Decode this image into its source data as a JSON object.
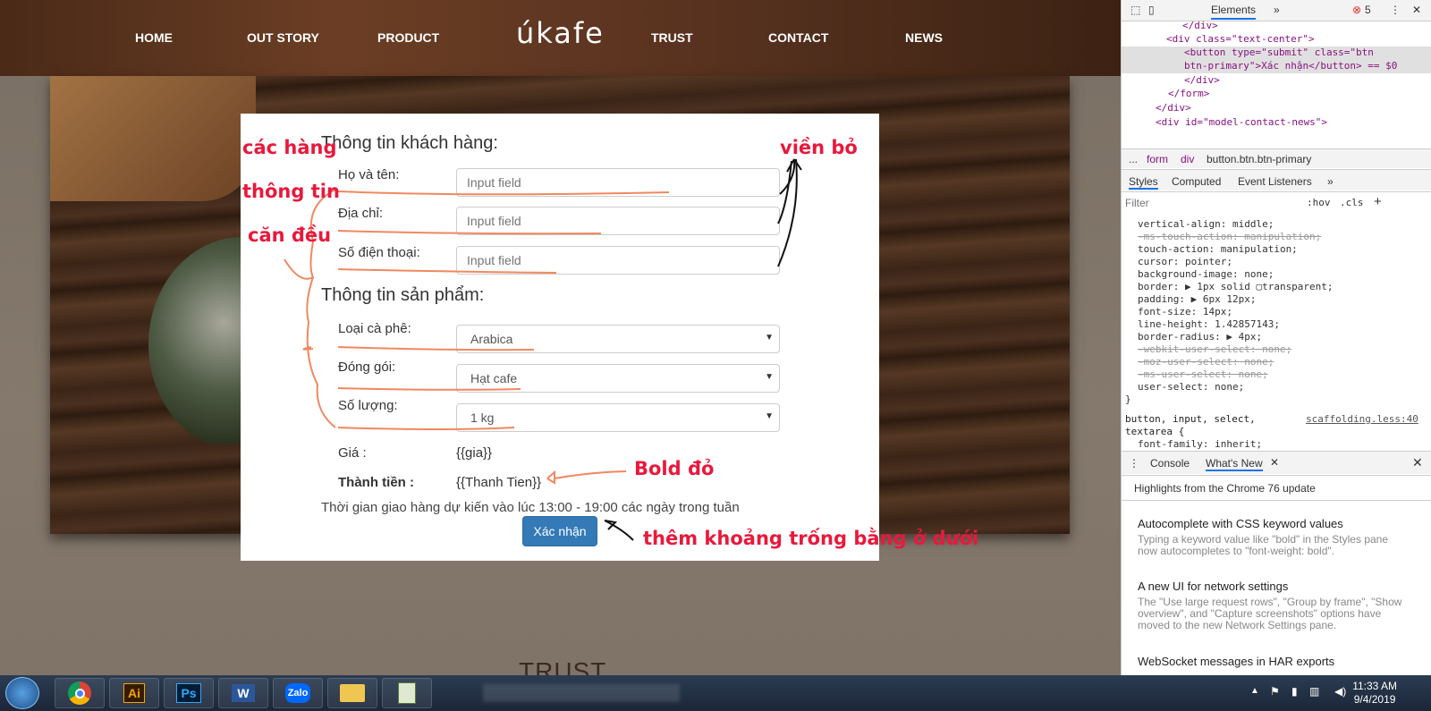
{
  "site": {
    "nav": {
      "home": "HOME",
      "story": "OUT STORY",
      "product": "PRODUCT",
      "logo": "úkafe",
      "trust": "TRUST",
      "contact": "CONTACT",
      "news": "NEWS"
    },
    "form": {
      "customer_title": "Thông tin khách hàng:",
      "name_label": "Họ và tên:",
      "address_label": "Địa chỉ:",
      "phone_label": "Số điện thoại:",
      "input_placeholder": "Input field",
      "product_title": "Thông tin sản phẩm:",
      "coffee_label": "Loại cà phê:",
      "coffee_value": "Arabica",
      "pack_label": "Đóng gói:",
      "pack_value": "Hạt cafe",
      "qty_label": "Số lượng:",
      "qty_value": "1 kg",
      "price_label": "Giá :",
      "price_value": "{{gia}}",
      "total_label": "Thành tiền :",
      "total_value": "{{Thanh Tien}}",
      "delivery_note": "Thời gian giao hàng dự kiến vào lúc 13:00 - 19:00 các ngày trong tuần",
      "submit_label": "Xác nhận"
    },
    "trust_heading": "TRUST"
  },
  "annotations": {
    "align_1": "các hàng",
    "align_2": "thông tin",
    "align_3": "căn đều",
    "border": "viền bỏ",
    "bold": "Bold đỏ",
    "spacing": "thêm khoảng trống bằng ở dưới",
    "color": "#e8193c"
  },
  "devtools": {
    "tab_elements": "Elements",
    "tab_more": "»",
    "error_count": "5",
    "html_lines": [
      "</div>",
      "<div class=\"text-center\">",
      "<button type=\"submit\" class=\"btn",
      "btn-primary\">Xác nhận</button> == $0",
      "</div>",
      "</form>",
      "</div>",
      "<div id=\"model-contact-news\">"
    ],
    "breadcrumb": [
      "...",
      "form",
      "div",
      "button.btn.btn-primary"
    ],
    "style_tabs": [
      "Styles",
      "Computed",
      "Event Listeners",
      "»"
    ],
    "filter_placeholder": "Filter",
    "hov": ":hov",
    "cls": ".cls",
    "css_lines": [
      "vertical-align: middle;",
      "-ms-touch-action: manipulation;",
      "touch-action: manipulation;",
      "cursor: pointer;",
      "background-image: none;",
      "border: ▶ 1px solid ▢transparent;",
      "padding: ▶ 6px 12px;",
      "font-size: 14px;",
      "line-height: 1.42857143;",
      "border-radius: ▶ 4px;",
      "-webkit-user-select: none;",
      "-moz-user-select: none;",
      "-ms-user-select: none;",
      "user-select: none;",
      "}"
    ],
    "selector": "button, input, select,",
    "selector2": "textarea {",
    "selector_source": "scaffolding.less:40",
    "font_family_line": "font-family: inherit;",
    "drawer_tabs": [
      "Console",
      "What's New"
    ],
    "highlights": "Highlights from the Chrome 76 update",
    "news": [
      {
        "title": "Autocomplete with CSS keyword values",
        "desc": "Typing a keyword value like \"bold\" in the Styles pane now autocompletes to \"font-weight: bold\"."
      },
      {
        "title": "A new UI for network settings",
        "desc": "The \"Use large request rows\", \"Group by frame\", \"Show overview\", and \"Capture screenshots\" options have moved to the new Network Settings pane."
      },
      {
        "title": "WebSocket messages in HAR exports",
        "desc": ""
      }
    ]
  },
  "taskbar": {
    "apps": [
      "Ai",
      "Ps",
      "W",
      "Zalo"
    ],
    "time": "11:33 AM",
    "date": "9/4/2019"
  }
}
